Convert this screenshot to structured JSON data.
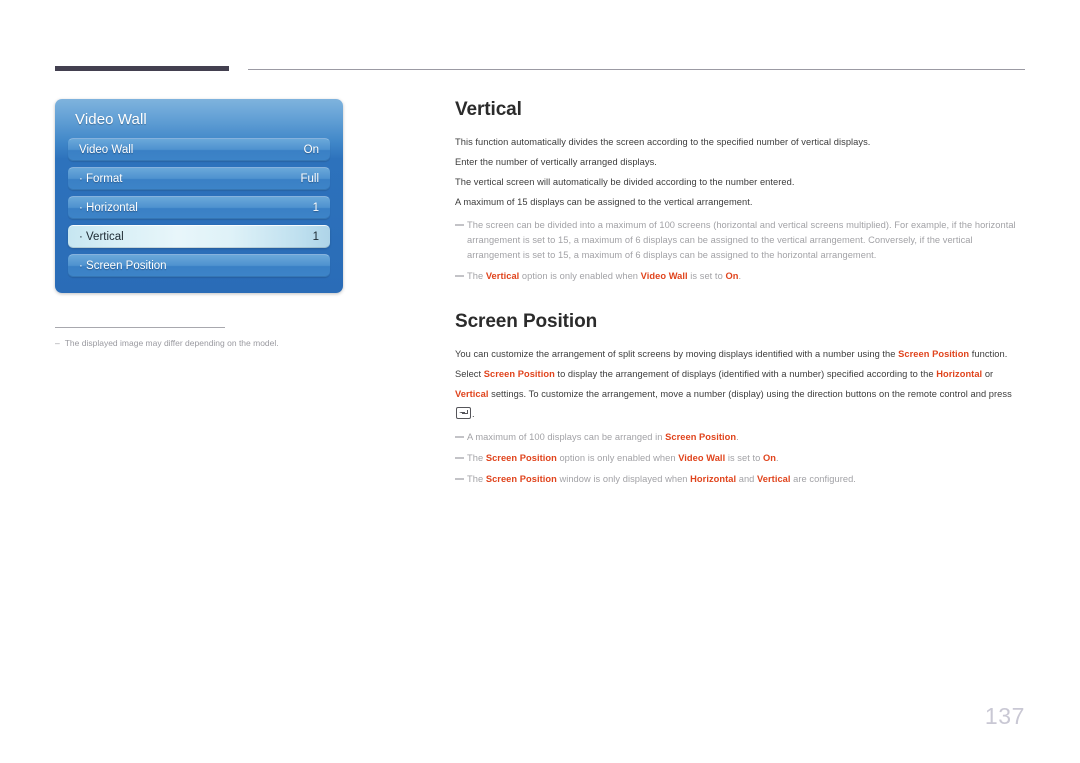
{
  "page": {
    "number": "137"
  },
  "osd": {
    "title": "Video Wall",
    "rows": [
      {
        "label": "Video Wall",
        "value": "On",
        "selected": false
      },
      {
        "label": "· Format",
        "value": "Full",
        "selected": false
      },
      {
        "label": "· Horizontal",
        "value": "1",
        "selected": false
      },
      {
        "label": "· Vertical",
        "value": "1",
        "selected": true
      },
      {
        "label": "· Screen Position",
        "value": "",
        "selected": false
      }
    ]
  },
  "left_note": {
    "dash": "–",
    "text": "The displayed image may differ depending on the model."
  },
  "vertical_section": {
    "heading": "Vertical",
    "paragraphs": [
      "This function automatically divides the screen according to the specified number of vertical displays.",
      "Enter the number of vertically arranged displays.",
      "The vertical screen will automatically be divided according to the number entered.",
      "A maximum of 15 displays can be assigned to the vertical arrangement."
    ],
    "note1": "The screen can be divided into a maximum of 100 screens (horizontal and vertical screens multiplied). For example, if the horizontal arrangement is set to 15, a maximum of 6 displays can be assigned to the vertical arrangement. Conversely, if the vertical arrangement is set to 15, a maximum of 6 displays can be assigned to the horizontal arrangement.",
    "note2": {
      "t1": "The ",
      "a1": "Vertical",
      "t2": " option is only enabled when ",
      "a2": "Video Wall",
      "t3": " is set to ",
      "a3": "On",
      "t4": "."
    }
  },
  "screen_position_section": {
    "heading": "Screen Position",
    "para1": {
      "t1": "You can customize the arrangement of split screens by moving displays identified with a number using the ",
      "a1": "Screen Position",
      "t2": " function."
    },
    "para2": {
      "t1": "Select ",
      "a1": "Screen Position",
      "t2": " to display the arrangement of displays (identified with a number) specified according to the ",
      "a2": "Horizontal",
      "t3": " or ",
      "a3": "Vertical",
      "t4": " settings. To customize the arrangement, move a number (display) using the direction buttons on the remote control and press ",
      "t5": "."
    },
    "note1": {
      "t1": "A maximum of 100 displays can be arranged in ",
      "a1": "Screen Position",
      "t2": "."
    },
    "note2": {
      "t1": "The ",
      "a1": "Screen Position",
      "t2": " option is only enabled when ",
      "a2": "Video Wall",
      "t3": " is set to ",
      "a3": "On",
      "t4": "."
    },
    "note3": {
      "t1": "The ",
      "a1": "Screen Position",
      "t2": " window is only displayed when ",
      "a2": "Horizontal",
      "t3": " and ",
      "a3": "Vertical",
      "t4": " are configured."
    }
  },
  "colors": {
    "accent_red": "#e0441d",
    "osd_blue": "#2a6cb7",
    "header_dark": "#434050",
    "page_number": "#c9c8d4"
  }
}
